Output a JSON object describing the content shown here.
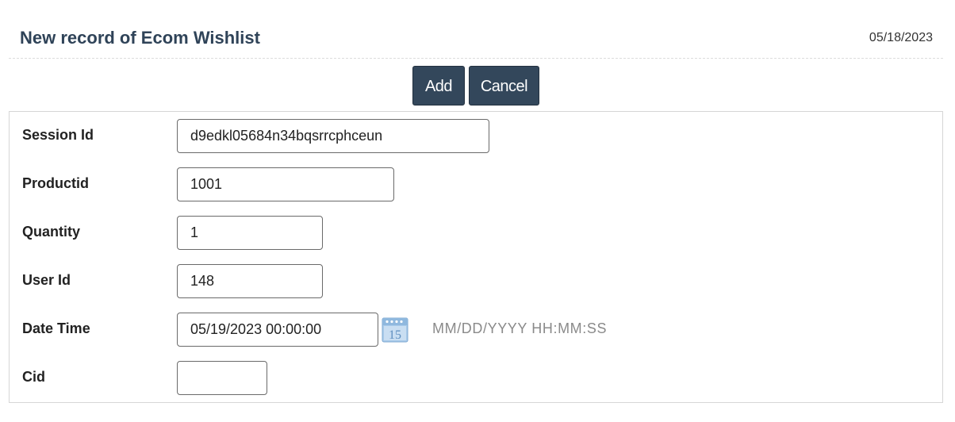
{
  "header": {
    "title": "New record of Ecom Wishlist",
    "date": "05/18/2023"
  },
  "toolbar": {
    "add_label": "Add",
    "cancel_label": "Cancel"
  },
  "form": {
    "fields": [
      {
        "label": "Session Id",
        "value": "d9edkl05684n34bqsrrcphceun"
      },
      {
        "label": "Productid",
        "value": "1001"
      },
      {
        "label": "Quantity",
        "value": "1"
      },
      {
        "label": "User Id",
        "value": "148"
      },
      {
        "label": "Date Time",
        "value": "05/19/2023 00:00:00",
        "format_hint": "MM/DD/YYYY HH:MM:SS",
        "icon": "calendar-icon"
      },
      {
        "label": "Cid",
        "value": ""
      }
    ]
  },
  "calendar": {
    "day_number": "15"
  },
  "colors": {
    "title": "#2f4358",
    "button_bg": "#33475b",
    "button_text": "#ffffff",
    "hint_text": "#8a8a8a",
    "calendar_icon": "#8fb8de"
  }
}
